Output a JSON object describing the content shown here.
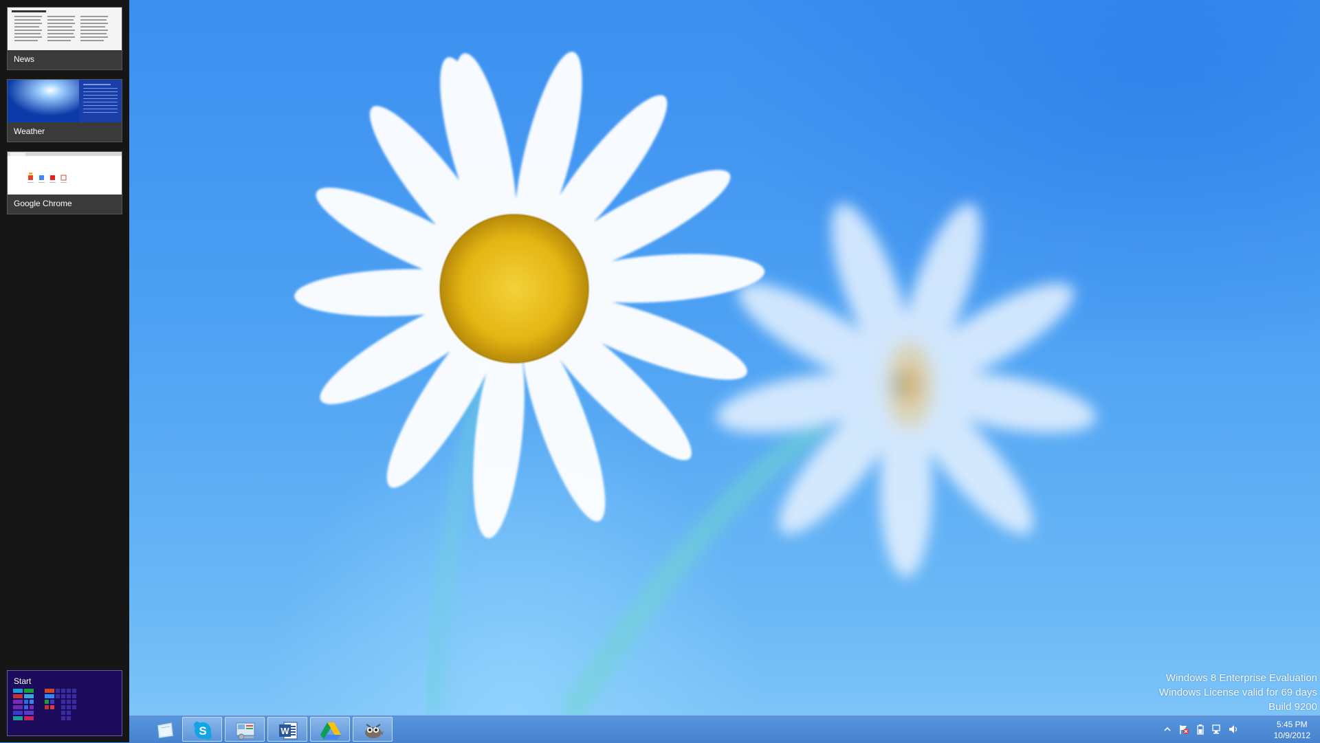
{
  "switch_list": {
    "apps": [
      {
        "label": "News"
      },
      {
        "label": "Weather"
      },
      {
        "label": "Google Chrome"
      }
    ],
    "start": {
      "label": "Start"
    }
  },
  "watermark": {
    "line1": "Windows 8 Enterprise Evaluation",
    "line2": "Windows License valid for 69 days",
    "line3": "Build 9200"
  },
  "taskbar": {
    "pinned": [
      {
        "icon": "file-explorer-icon"
      },
      {
        "icon": "skype-icon"
      },
      {
        "icon": "control-panel-icon"
      },
      {
        "icon": "word-icon"
      },
      {
        "icon": "google-drive-icon"
      },
      {
        "icon": "gimp-icon"
      }
    ],
    "tray": {
      "icons": [
        "show-hidden-icons-chevron",
        "action-center-flag-icon",
        "power-icon",
        "network-icon",
        "volume-icon"
      ],
      "time": "5:45 PM",
      "date": "10/9/2012"
    }
  },
  "colors": {
    "wallpaper_blue": "#4da1f3",
    "switch_list_bg": "#161616",
    "start_bg": "#1c0a5a",
    "daisy_center": "#f1c21b"
  }
}
